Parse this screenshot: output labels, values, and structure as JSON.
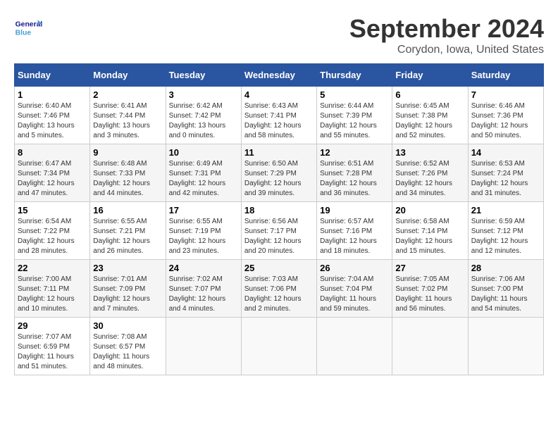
{
  "header": {
    "logo_text_general": "General",
    "logo_text_blue": "Blue",
    "month_title": "September 2024",
    "location": "Corydon, Iowa, United States"
  },
  "calendar": {
    "days_of_week": [
      "Sunday",
      "Monday",
      "Tuesday",
      "Wednesday",
      "Thursday",
      "Friday",
      "Saturday"
    ],
    "weeks": [
      [
        {
          "day": "1",
          "info": "Sunrise: 6:40 AM\nSunset: 7:46 PM\nDaylight: 13 hours and 5 minutes."
        },
        {
          "day": "2",
          "info": "Sunrise: 6:41 AM\nSunset: 7:44 PM\nDaylight: 13 hours and 3 minutes."
        },
        {
          "day": "3",
          "info": "Sunrise: 6:42 AM\nSunset: 7:42 PM\nDaylight: 13 hours and 0 minutes."
        },
        {
          "day": "4",
          "info": "Sunrise: 6:43 AM\nSunset: 7:41 PM\nDaylight: 12 hours and 58 minutes."
        },
        {
          "day": "5",
          "info": "Sunrise: 6:44 AM\nSunset: 7:39 PM\nDaylight: 12 hours and 55 minutes."
        },
        {
          "day": "6",
          "info": "Sunrise: 6:45 AM\nSunset: 7:38 PM\nDaylight: 12 hours and 52 minutes."
        },
        {
          "day": "7",
          "info": "Sunrise: 6:46 AM\nSunset: 7:36 PM\nDaylight: 12 hours and 50 minutes."
        }
      ],
      [
        {
          "day": "8",
          "info": "Sunrise: 6:47 AM\nSunset: 7:34 PM\nDaylight: 12 hours and 47 minutes."
        },
        {
          "day": "9",
          "info": "Sunrise: 6:48 AM\nSunset: 7:33 PM\nDaylight: 12 hours and 44 minutes."
        },
        {
          "day": "10",
          "info": "Sunrise: 6:49 AM\nSunset: 7:31 PM\nDaylight: 12 hours and 42 minutes."
        },
        {
          "day": "11",
          "info": "Sunrise: 6:50 AM\nSunset: 7:29 PM\nDaylight: 12 hours and 39 minutes."
        },
        {
          "day": "12",
          "info": "Sunrise: 6:51 AM\nSunset: 7:28 PM\nDaylight: 12 hours and 36 minutes."
        },
        {
          "day": "13",
          "info": "Sunrise: 6:52 AM\nSunset: 7:26 PM\nDaylight: 12 hours and 34 minutes."
        },
        {
          "day": "14",
          "info": "Sunrise: 6:53 AM\nSunset: 7:24 PM\nDaylight: 12 hours and 31 minutes."
        }
      ],
      [
        {
          "day": "15",
          "info": "Sunrise: 6:54 AM\nSunset: 7:22 PM\nDaylight: 12 hours and 28 minutes."
        },
        {
          "day": "16",
          "info": "Sunrise: 6:55 AM\nSunset: 7:21 PM\nDaylight: 12 hours and 26 minutes."
        },
        {
          "day": "17",
          "info": "Sunrise: 6:55 AM\nSunset: 7:19 PM\nDaylight: 12 hours and 23 minutes."
        },
        {
          "day": "18",
          "info": "Sunrise: 6:56 AM\nSunset: 7:17 PM\nDaylight: 12 hours and 20 minutes."
        },
        {
          "day": "19",
          "info": "Sunrise: 6:57 AM\nSunset: 7:16 PM\nDaylight: 12 hours and 18 minutes."
        },
        {
          "day": "20",
          "info": "Sunrise: 6:58 AM\nSunset: 7:14 PM\nDaylight: 12 hours and 15 minutes."
        },
        {
          "day": "21",
          "info": "Sunrise: 6:59 AM\nSunset: 7:12 PM\nDaylight: 12 hours and 12 minutes."
        }
      ],
      [
        {
          "day": "22",
          "info": "Sunrise: 7:00 AM\nSunset: 7:11 PM\nDaylight: 12 hours and 10 minutes."
        },
        {
          "day": "23",
          "info": "Sunrise: 7:01 AM\nSunset: 7:09 PM\nDaylight: 12 hours and 7 minutes."
        },
        {
          "day": "24",
          "info": "Sunrise: 7:02 AM\nSunset: 7:07 PM\nDaylight: 12 hours and 4 minutes."
        },
        {
          "day": "25",
          "info": "Sunrise: 7:03 AM\nSunset: 7:06 PM\nDaylight: 12 hours and 2 minutes."
        },
        {
          "day": "26",
          "info": "Sunrise: 7:04 AM\nSunset: 7:04 PM\nDaylight: 11 hours and 59 minutes."
        },
        {
          "day": "27",
          "info": "Sunrise: 7:05 AM\nSunset: 7:02 PM\nDaylight: 11 hours and 56 minutes."
        },
        {
          "day": "28",
          "info": "Sunrise: 7:06 AM\nSunset: 7:00 PM\nDaylight: 11 hours and 54 minutes."
        }
      ],
      [
        {
          "day": "29",
          "info": "Sunrise: 7:07 AM\nSunset: 6:59 PM\nDaylight: 11 hours and 51 minutes."
        },
        {
          "day": "30",
          "info": "Sunrise: 7:08 AM\nSunset: 6:57 PM\nDaylight: 11 hours and 48 minutes."
        },
        {
          "day": "",
          "info": ""
        },
        {
          "day": "",
          "info": ""
        },
        {
          "day": "",
          "info": ""
        },
        {
          "day": "",
          "info": ""
        },
        {
          "day": "",
          "info": ""
        }
      ]
    ]
  }
}
